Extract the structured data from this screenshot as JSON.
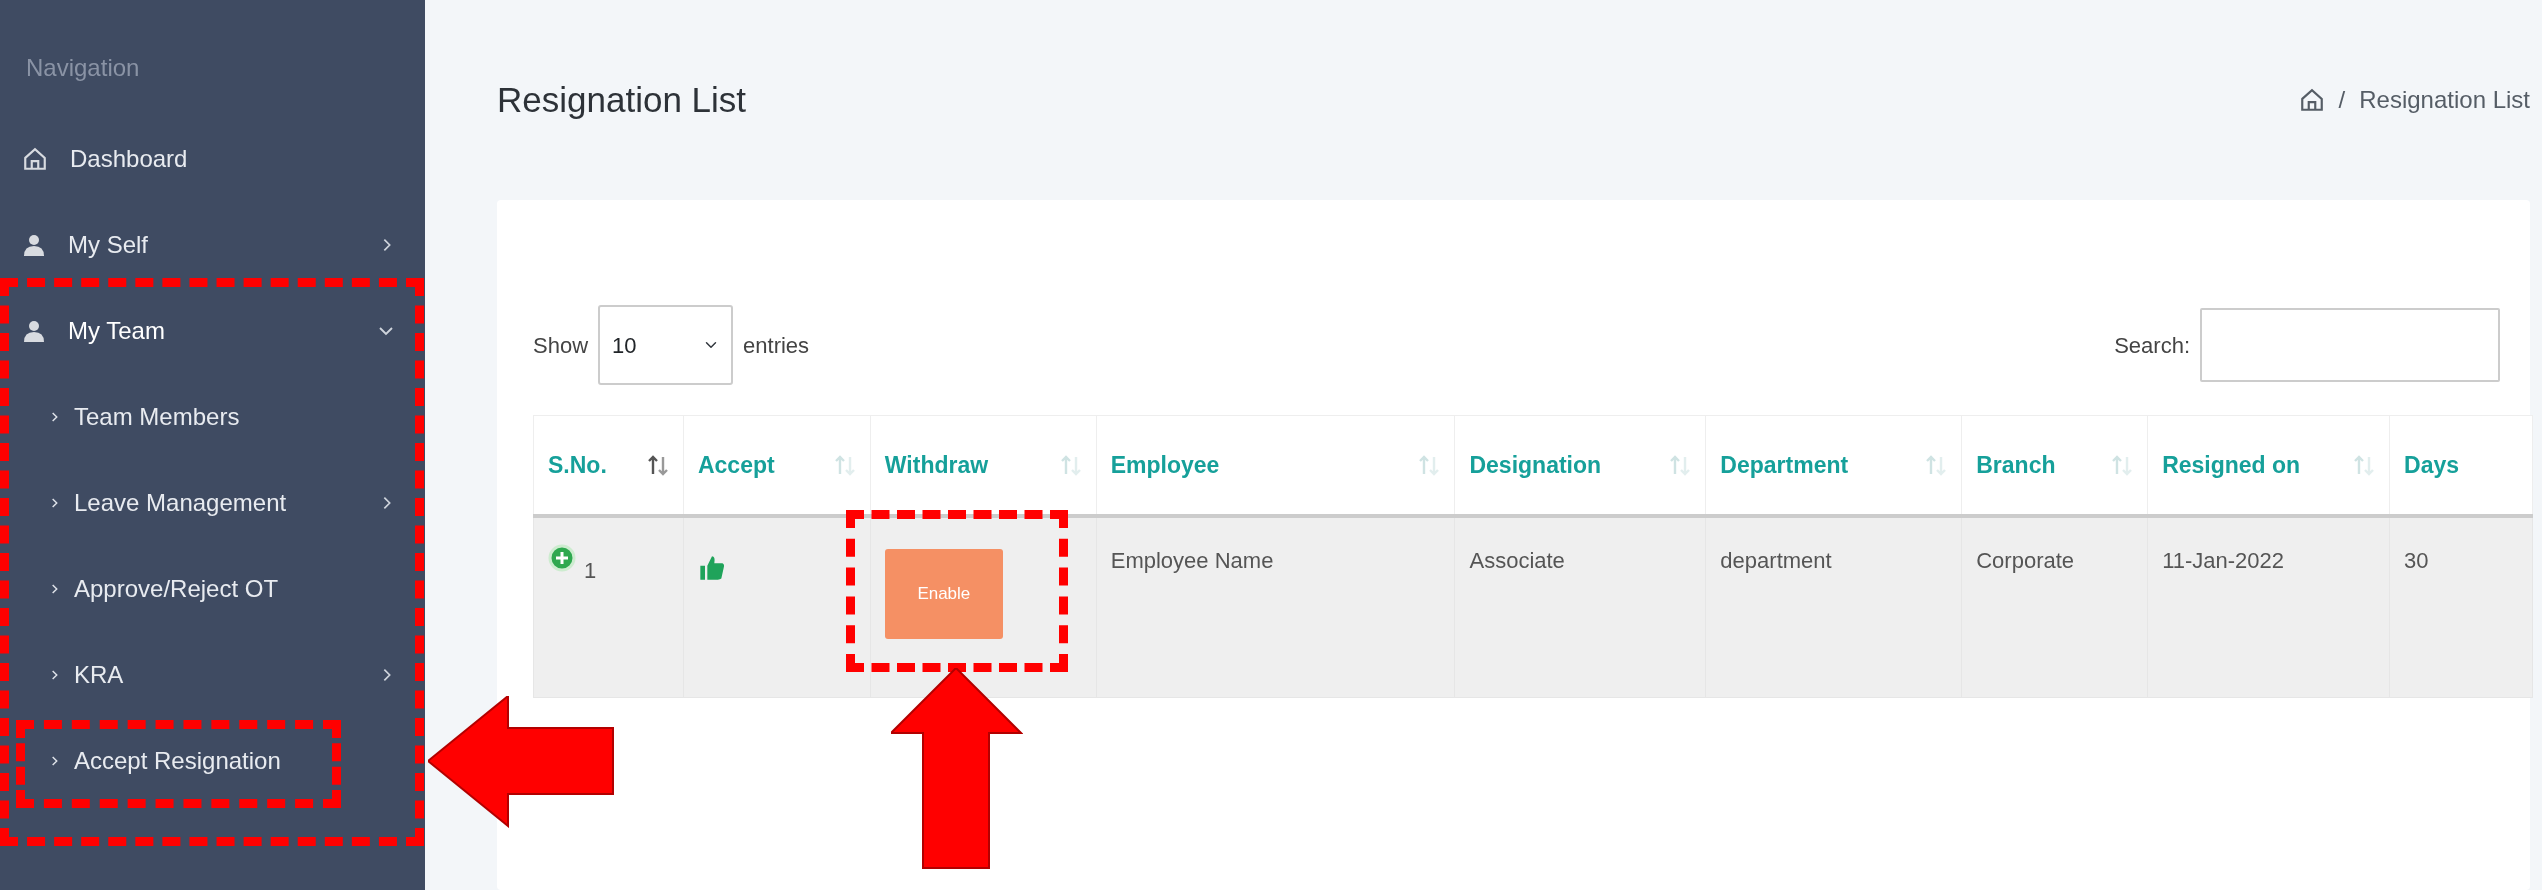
{
  "sidebar": {
    "heading": "Navigation",
    "items": [
      {
        "label": "Dashboard",
        "kind": "link"
      },
      {
        "label": "My Self",
        "kind": "menu",
        "expanded": false
      },
      {
        "label": "My Team",
        "kind": "menu",
        "expanded": true,
        "framed": true,
        "children": [
          {
            "label": "Team Members",
            "kind": "link"
          },
          {
            "label": "Leave Management",
            "kind": "menu",
            "expanded": false
          },
          {
            "label": "Approve/Reject OT",
            "kind": "link"
          },
          {
            "label": "KRA",
            "kind": "menu",
            "expanded": false
          },
          {
            "label": "Accept Resignation",
            "kind": "link",
            "framed": true,
            "arrow": true
          }
        ]
      }
    ]
  },
  "page": {
    "title": "Resignation List",
    "breadcrumb": {
      "separator": "/",
      "current": "Resignation List"
    }
  },
  "table": {
    "length": {
      "before": "Show",
      "value": "10",
      "after": "entries"
    },
    "search": {
      "label": "Search:"
    },
    "columns": [
      {
        "label": "S.No.",
        "sortable": true,
        "sorted": true
      },
      {
        "label": "Accept",
        "sortable": true,
        "sorted": false
      },
      {
        "label": "Withdraw",
        "sortable": true,
        "sorted": false
      },
      {
        "label": "Employee",
        "sortable": true,
        "sorted": false
      },
      {
        "label": "Designation",
        "sortable": true,
        "sorted": false
      },
      {
        "label": "Department",
        "sortable": true,
        "sorted": false
      },
      {
        "label": "Branch",
        "sortable": true,
        "sorted": false
      },
      {
        "label": "Resigned on",
        "sortable": true,
        "sorted": false
      },
      {
        "label": "Days",
        "sortable": false
      }
    ],
    "rows": [
      {
        "sno": "1",
        "accepted": true,
        "withdraw": {
          "label": "Enable",
          "framed": true,
          "arrow": true
        },
        "employee": "Employee Name",
        "designation": "Associate",
        "department": "department",
        "branch": "Corporate",
        "resigned_on": "11-Jan-2022",
        "days": "30"
      }
    ]
  }
}
